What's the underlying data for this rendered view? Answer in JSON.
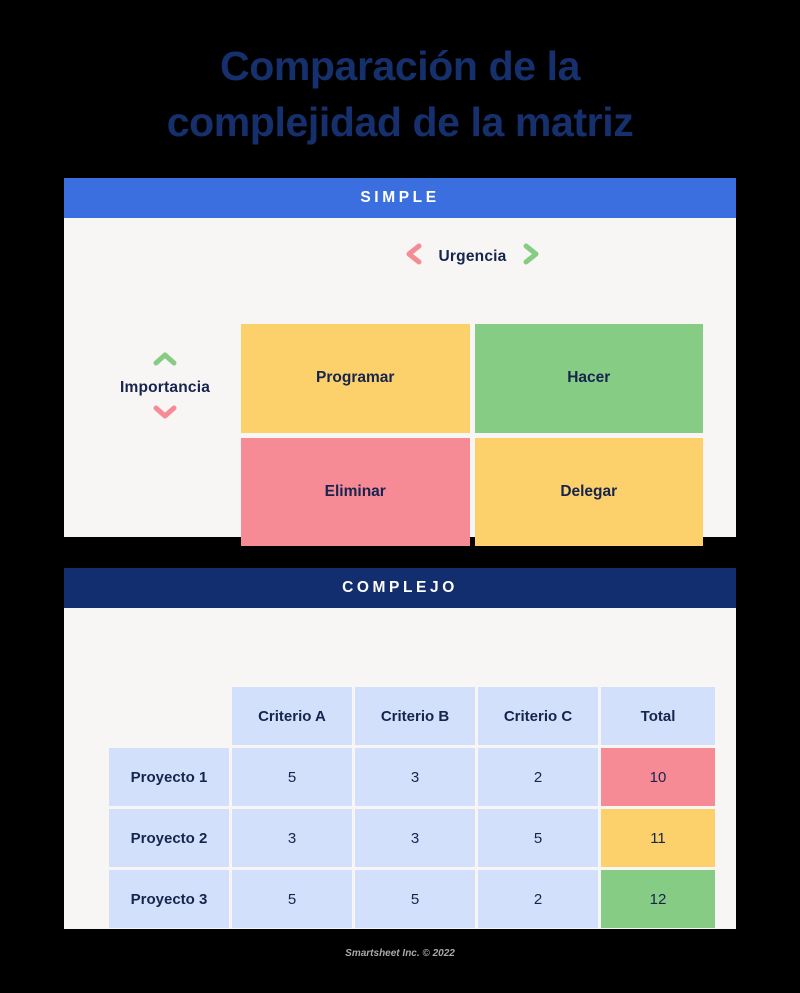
{
  "title": {
    "line1": "Comparación de la",
    "line2": "complejidad de la matriz"
  },
  "simple": {
    "band_label": "SIMPLE",
    "x_axis_label": "Urgencia",
    "y_axis_label": "Importancia",
    "quadrants": [
      {
        "label": "Programar",
        "color": "#FCD06A"
      },
      {
        "label": "Hacer",
        "color": "#87CC84"
      },
      {
        "label": "Eliminar",
        "color": "#F78B95"
      },
      {
        "label": "Delegar",
        "color": "#FCD06A"
      }
    ]
  },
  "complex": {
    "band_label": "COMPLEJO",
    "corner_label": "",
    "columns": [
      "Criterio A",
      "Criterio B",
      "Criterio C",
      "Total"
    ],
    "rows": [
      {
        "name": "Proyecto 1",
        "values": [
          "5",
          "3",
          "2"
        ],
        "total": "10",
        "total_color": "#F78B95"
      },
      {
        "name": "Proyecto 2",
        "values": [
          "3",
          "3",
          "5"
        ],
        "total": "11",
        "total_color": "#FCD06A"
      },
      {
        "name": "Proyecto 3",
        "values": [
          "5",
          "5",
          "2"
        ],
        "total": "12",
        "total_color": "#87CC84"
      }
    ]
  },
  "footer": {
    "credit": "Smartsheet Inc. © 2022"
  },
  "colors": {
    "page_background": "#000000",
    "card_background": "#F7F6F4",
    "title_navy": "#16306E",
    "band_blue": "#3B6FE0",
    "band_navy": "#132E6E",
    "cell_blue": "#D3E0FB",
    "text_navy": "#16244E",
    "accent_green": "#87CC84",
    "accent_pink": "#F78B95",
    "accent_yellow": "#FCD06A"
  }
}
